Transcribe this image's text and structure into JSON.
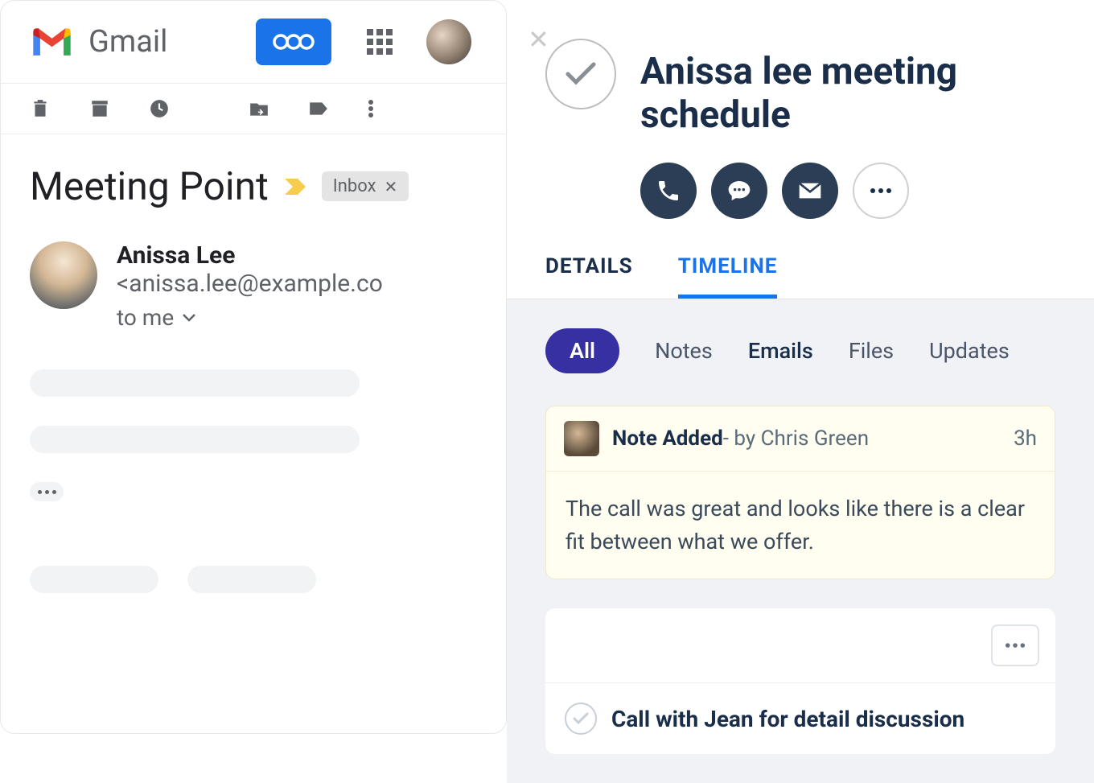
{
  "gmail": {
    "title": "Gmail",
    "email": {
      "subject": "Meeting Point",
      "inbox_label": "Inbox",
      "sender_name": "Anissa Lee",
      "sender_email": "<anissa.lee@example.co",
      "to_line": "to me"
    }
  },
  "crm": {
    "title": "Anissa lee meeting schedule",
    "tabs": {
      "details": "DETAILS",
      "timeline": "TIMELINE"
    },
    "filters": {
      "all": "All",
      "notes": "Notes",
      "emails": "Emails",
      "files": "Files",
      "updates": "Updates"
    },
    "note": {
      "title": "Note Added",
      "by": " - by Chris Green",
      "time": "3h",
      "body": "The call was great and looks like there is a clear fit between what we offer."
    },
    "task": {
      "title": "Call with Jean for detail discussion"
    }
  }
}
